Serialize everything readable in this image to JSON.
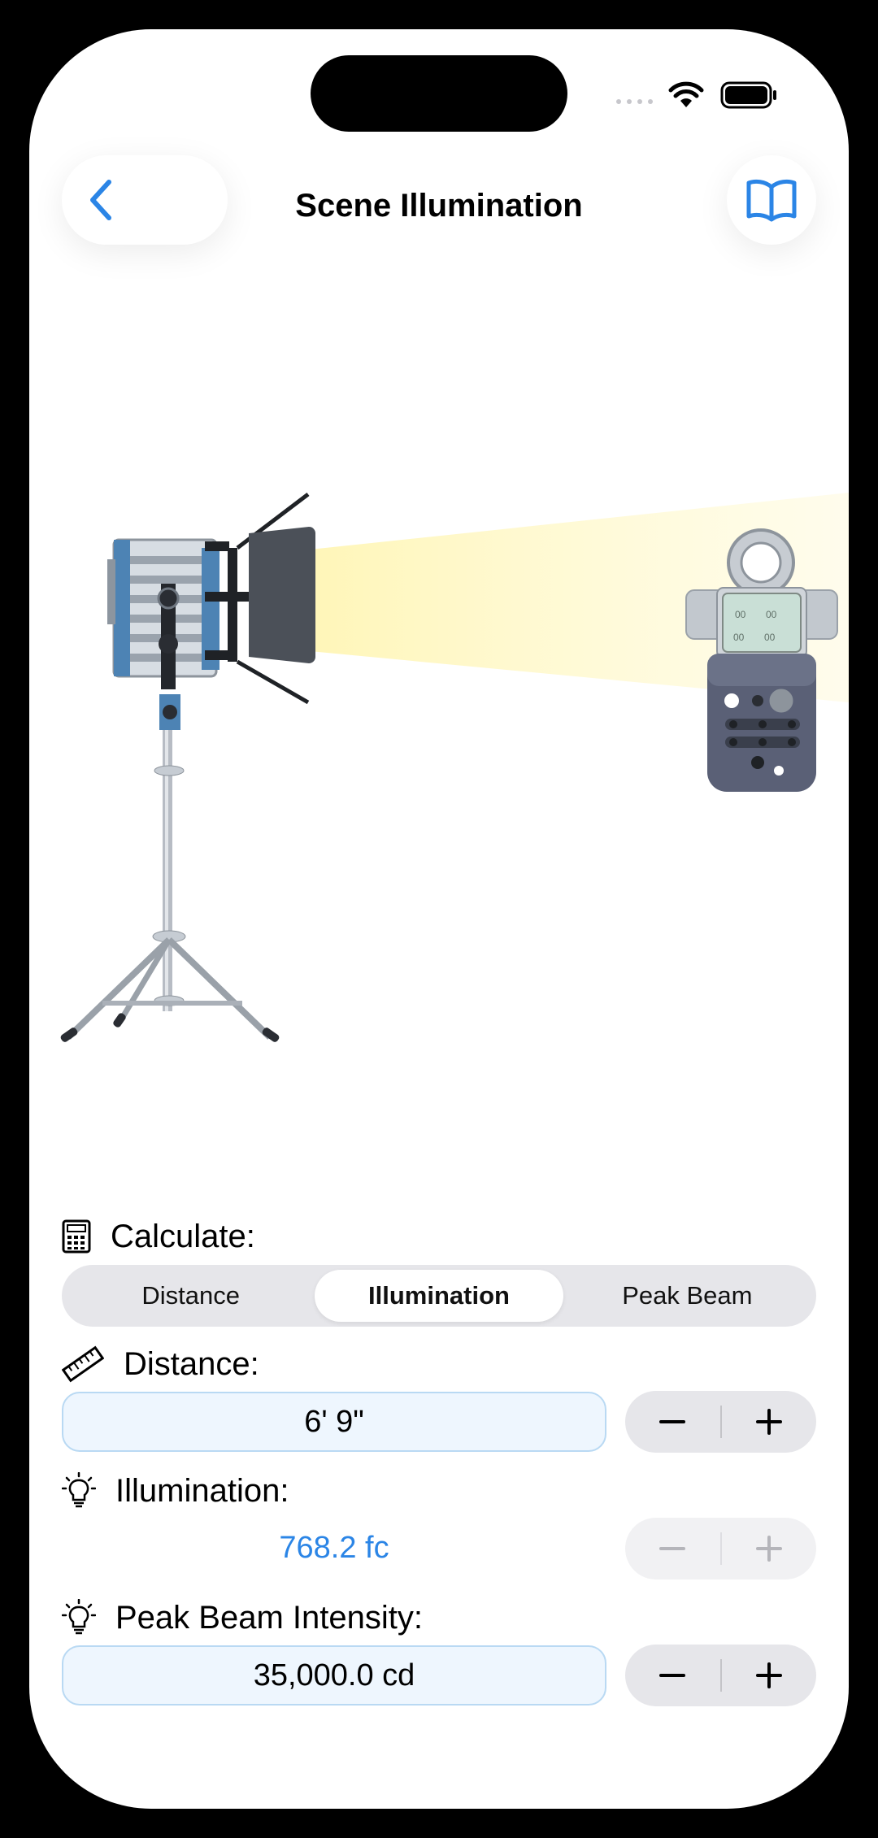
{
  "nav": {
    "title": "Scene Illumination"
  },
  "calculate": {
    "label": "Calculate:",
    "options": [
      "Distance",
      "Illumination",
      "Peak Beam"
    ],
    "selected": "Illumination"
  },
  "distance": {
    "label": "Distance:",
    "value": "6' 9\""
  },
  "illumination": {
    "label": "Illumination:",
    "value": "768.2 fc"
  },
  "peak_beam": {
    "label": "Peak Beam Intensity:",
    "value": "35,000.0 cd"
  },
  "stepper": {
    "minus": "−",
    "plus": "+"
  },
  "colors": {
    "accent": "#2b85e6",
    "field_bg": "#eef6fe",
    "field_border": "#b9d9f3",
    "segment_bg": "#e6e6ea"
  },
  "icons": {
    "back": "chevron-left-icon",
    "reference": "book-icon",
    "calculate": "calculator-icon",
    "distance": "ruler-icon",
    "illumination": "lightbulb-icon",
    "peak_beam": "lightbulb-icon"
  }
}
